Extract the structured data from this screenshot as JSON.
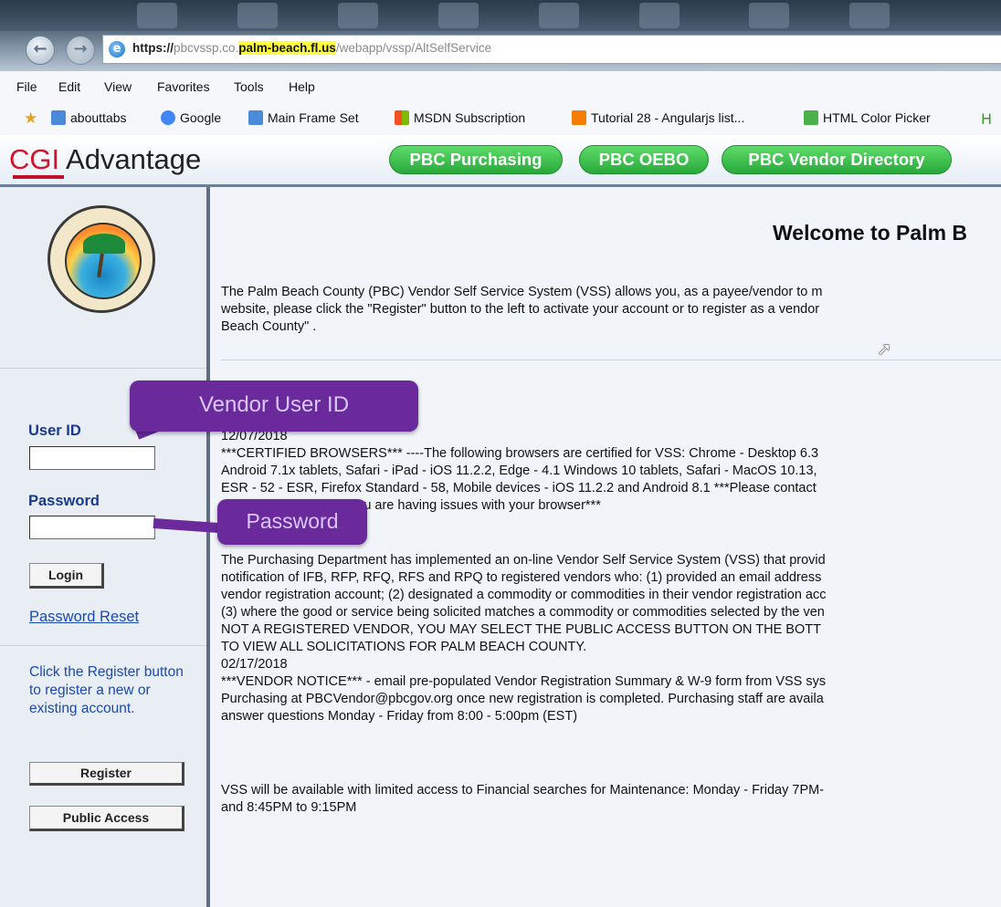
{
  "browser": {
    "url_prefix": "https://",
    "url_host_a": "pbcvssp.co.",
    "url_host_b": "palm-beach.fl.us",
    "url_path": "/webapp/vssp/AltSelfService",
    "menus": [
      "File",
      "Edit",
      "View",
      "Favorites",
      "Tools",
      "Help"
    ],
    "favorites": [
      "abouttabs",
      "Google",
      "Main Frame Set",
      "MSDN Subscription",
      "Tutorial 28 - Angularjs list...",
      "HTML Color Picker"
    ],
    "nav": {
      "back_icon": "←",
      "forward_icon": "→"
    }
  },
  "header": {
    "brand_prefix": "CGI",
    "brand_suffix": " Advantage",
    "links": [
      "PBC Purchasing",
      "PBC OEBO",
      "PBC Vendor Directory"
    ],
    "link_color": "#2fb845"
  },
  "sidebar": {
    "user_id_label": "User ID",
    "password_label": "Password",
    "login_button": "Login",
    "password_reset_link": "Password Reset",
    "register_text": "Click the Register button to register a new or existing account.",
    "register_button": "Register",
    "public_access_button": "Public Access",
    "user_id_value": "",
    "password_value": ""
  },
  "main": {
    "welcome_title": "Welcome to Palm B",
    "intro_lines": [
      "The Palm Beach County (PBC) Vendor Self Service System (VSS) allows you, as a payee/vendor to m",
      "website, please click the \"Register\" button to the left to activate your account or to register as a vendor",
      "Beach County\" ."
    ],
    "notice_1_date": "12/07/2018",
    "notice_1_lines": [
      "***CERTIFIED BROWSERS*** ----The following browsers are certified for VSS: Chrome - Desktop 6.3",
      "Android 7.1x tablets, Safari - iPad - iOS 11.2.2, Edge - 4.1 Windows 10 tablets, Safari - MacOS 10.13,",
      "ESR - 52 - ESR, Firefox Standard - 58, Mobile devices - iOS 11.2.2 and Android 8.1 ***Please contact",
      "                          org if you are having issues with your browser***"
    ],
    "notice_2_lines": [
      "The Purchasing Department has implemented an on-line Vendor Self Service System (VSS) that provid",
      "notification of IFB, RFP, RFQ, RFS and RPQ to registered vendors who: (1) provided an email address",
      "vendor registration account; (2) designated a commodity or commodities in their vendor registration acc",
      "(3) where the good or service being solicited matches a commodity or commodities selected by the ven",
      "NOT A REGISTERED VENDOR, YOU MAY SELECT THE PUBLIC ACCESS BUTTON ON THE BOTT",
      "TO VIEW ALL SOLICITATIONS FOR PALM BEACH COUNTY."
    ],
    "notice_3_date": "02/17/2018",
    "notice_3_lines": [
      "***VENDOR NOTICE*** - email pre-populated Vendor Registration Summary & W-9 form from VSS sys",
      "Purchasing at PBCVendor@pbcgov.org once new registration is completed. Purchasing staff are availa",
      "answer questions Monday - Friday from 8:00 - 5:00pm (EST)"
    ],
    "notice_4_lines": [
      "VSS will be available with limited access to Financial searches for Maintenance: Monday - Friday 7PM-",
      "and 8:45PM to 9:15PM"
    ]
  },
  "annotations": {
    "vendor_user_id": "Vendor User ID",
    "password": "Password",
    "callout_color": "#6a2a9c"
  }
}
